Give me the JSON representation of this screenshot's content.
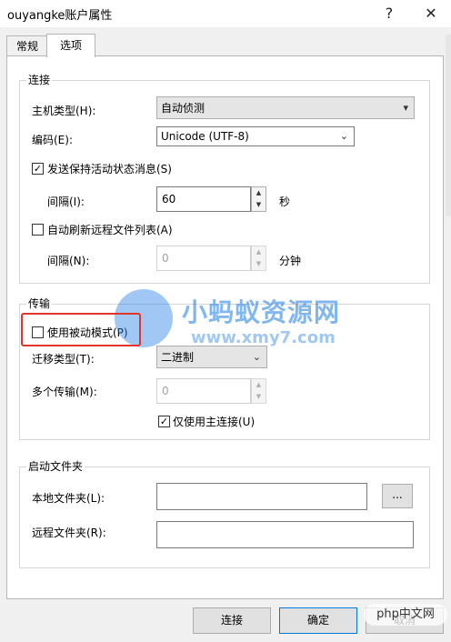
{
  "window": {
    "title": "ouyangke账户属性",
    "help_icon": "?",
    "close_icon": "✕"
  },
  "tabs": [
    {
      "label": "常规",
      "active": false
    },
    {
      "label": "选项",
      "active": true
    }
  ],
  "connection": {
    "title": "连接",
    "host_type_label": "主机类型(H):",
    "host_type_value": "自动侦测",
    "encoding_label": "编码(E):",
    "encoding_value": "Unicode (UTF-8)",
    "keepalive_label": "发送保持活动状态消息(S)",
    "keepalive_checked": true,
    "interval_label": "间隔(I):",
    "interval_value": "60",
    "interval_unit": "秒",
    "autorefresh_label": "自动刷新远程文件列表(A)",
    "autorefresh_checked": false,
    "refresh_interval_label": "间隔(N):",
    "refresh_interval_value": "0",
    "refresh_interval_unit": "分钟"
  },
  "transfer": {
    "title": "传输",
    "passive_label": "使用被动模式(P)",
    "passive_checked": false,
    "type_label": "迁移类型(T):",
    "type_value": "二进制",
    "multi_label": "多个传输(M):",
    "multi_value": "0",
    "main_only_label": "仅使用主连接(U)",
    "main_only_checked": true
  },
  "startup": {
    "title": "启动文件夹",
    "local_label": "本地文件夹(L):",
    "local_value": "",
    "browse_label": "...",
    "remote_label": "远程文件夹(R):",
    "remote_value": ""
  },
  "buttons": {
    "connect": "连接",
    "ok": "确定",
    "cancel": "取消"
  },
  "watermark": {
    "site_name": "小蚂蚁资源网",
    "site_url": "www.xmy7.com",
    "corner_logo": "php中文网"
  },
  "colors": {
    "highlight_box": "#e0352b",
    "watermark_blue": "#2f86e6",
    "default_button_border": "#0078d7"
  }
}
